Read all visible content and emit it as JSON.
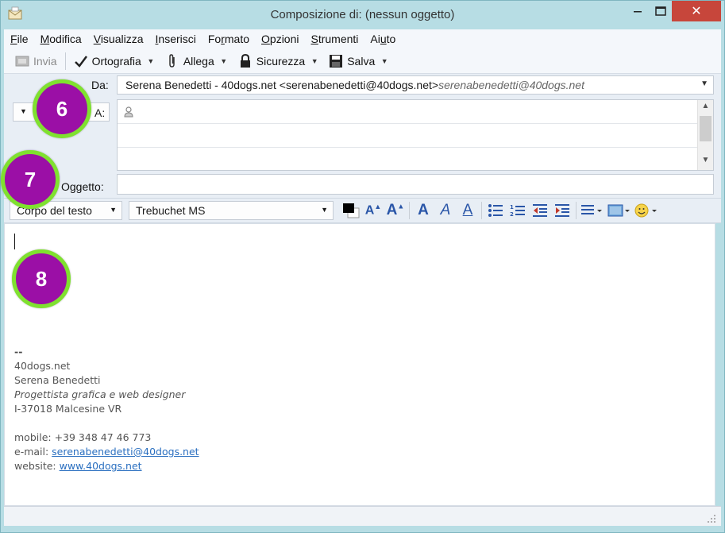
{
  "window": {
    "title": "Composizione di: (nessun oggetto)",
    "close_glyph": "✕"
  },
  "menu": [
    {
      "label": "File",
      "accel": "F",
      "rest": "ile"
    },
    {
      "label": "Modifica",
      "accel": "M",
      "rest": "odifica"
    },
    {
      "label": "Visualizza",
      "accel": "V",
      "rest": "isualizza"
    },
    {
      "label": "Inserisci",
      "accel": "I",
      "rest": "nserisci"
    },
    {
      "label": "Formato",
      "pre": "Fo",
      "accel": "r",
      "rest": "mato"
    },
    {
      "label": "Opzioni",
      "accel": "O",
      "rest": "pzioni"
    },
    {
      "label": "Strumenti",
      "accel": "S",
      "rest": "trumenti"
    },
    {
      "label": "Aiuto",
      "pre": "Ai",
      "accel": "u",
      "rest": "to"
    }
  ],
  "toolbar": {
    "send": "Invia",
    "spelling": "Ortografia",
    "attach": "Allega",
    "security": "Sicurezza",
    "save": "Salva"
  },
  "header": {
    "from_label": "Da:",
    "from_value": "Serena Benedetti - 40dogs.net <serenabenedetti@40dogs.net>",
    "from_alt": "serenabenedetti@40dogs.net",
    "to_label": "A:",
    "subject_label": "Oggetto:",
    "subject_value": ""
  },
  "format": {
    "paragraph_style": "Corpo del testo",
    "font": "Trebuchet MS"
  },
  "signature": {
    "separator": "--",
    "company": "40dogs.net",
    "name": "Serena Benedetti",
    "role": "Progettista grafica e web designer",
    "address": "I-37018 Malcesine VR",
    "mobile": "mobile: +39 348 47 46 773",
    "email_label": "e-mail: ",
    "email": "serenabenedetti@40dogs.net",
    "website_label": "website: ",
    "website": "www.40dogs.net"
  },
  "annotations": {
    "badge_6": "6",
    "badge_7": "7",
    "badge_8": "8"
  },
  "colors": {
    "badge_fill": "#9b0fa6",
    "badge_ring": "#7fe12f",
    "close_button": "#c7463b",
    "link": "#2a6fc0"
  }
}
